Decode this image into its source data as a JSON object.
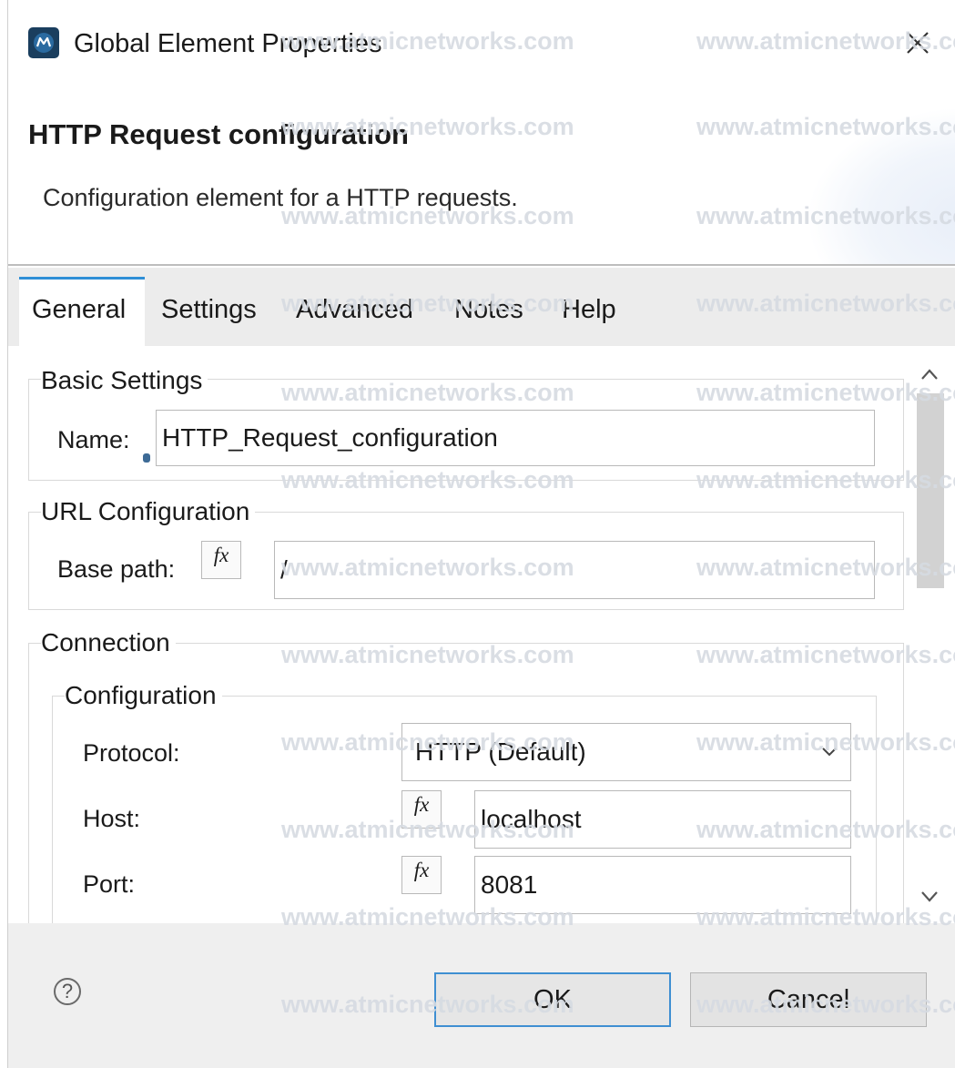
{
  "window": {
    "title": "Global Element Properties",
    "icon": "mule-app-icon",
    "close_icon": "close-icon"
  },
  "header": {
    "title": "HTTP Request configuration",
    "description": "Configuration element for a HTTP requests."
  },
  "tabs": [
    {
      "label": "General",
      "active": true
    },
    {
      "label": "Settings",
      "active": false
    },
    {
      "label": "Advanced",
      "active": false
    },
    {
      "label": "Notes",
      "active": false
    },
    {
      "label": "Help",
      "active": false
    }
  ],
  "basic_settings": {
    "group_label": "Basic Settings",
    "name_label": "Name:",
    "name_value": "HTTP_Request_configuration"
  },
  "url_configuration": {
    "group_label": "URL Configuration",
    "base_path_label": "Base path:",
    "fx_label": "fx",
    "base_path_value": "/"
  },
  "connection": {
    "group_label": "Connection",
    "configuration": {
      "group_label": "Configuration",
      "protocol_label": "Protocol:",
      "protocol_value": "HTTP (Default)",
      "host_label": "Host:",
      "host_value": "localhost",
      "port_label": "Port:",
      "port_value": "8081",
      "fx_label": "fx"
    }
  },
  "footer": {
    "help_symbol": "?",
    "ok_label": "OK",
    "cancel_label": "Cancel"
  },
  "watermark": "www.atmicnetworks.com",
  "colors": {
    "accent": "#2f8fd6",
    "footer_bg": "#efefef",
    "tabbar_bg": "#ececec",
    "app_icon_bg": "#1a3e5e"
  }
}
